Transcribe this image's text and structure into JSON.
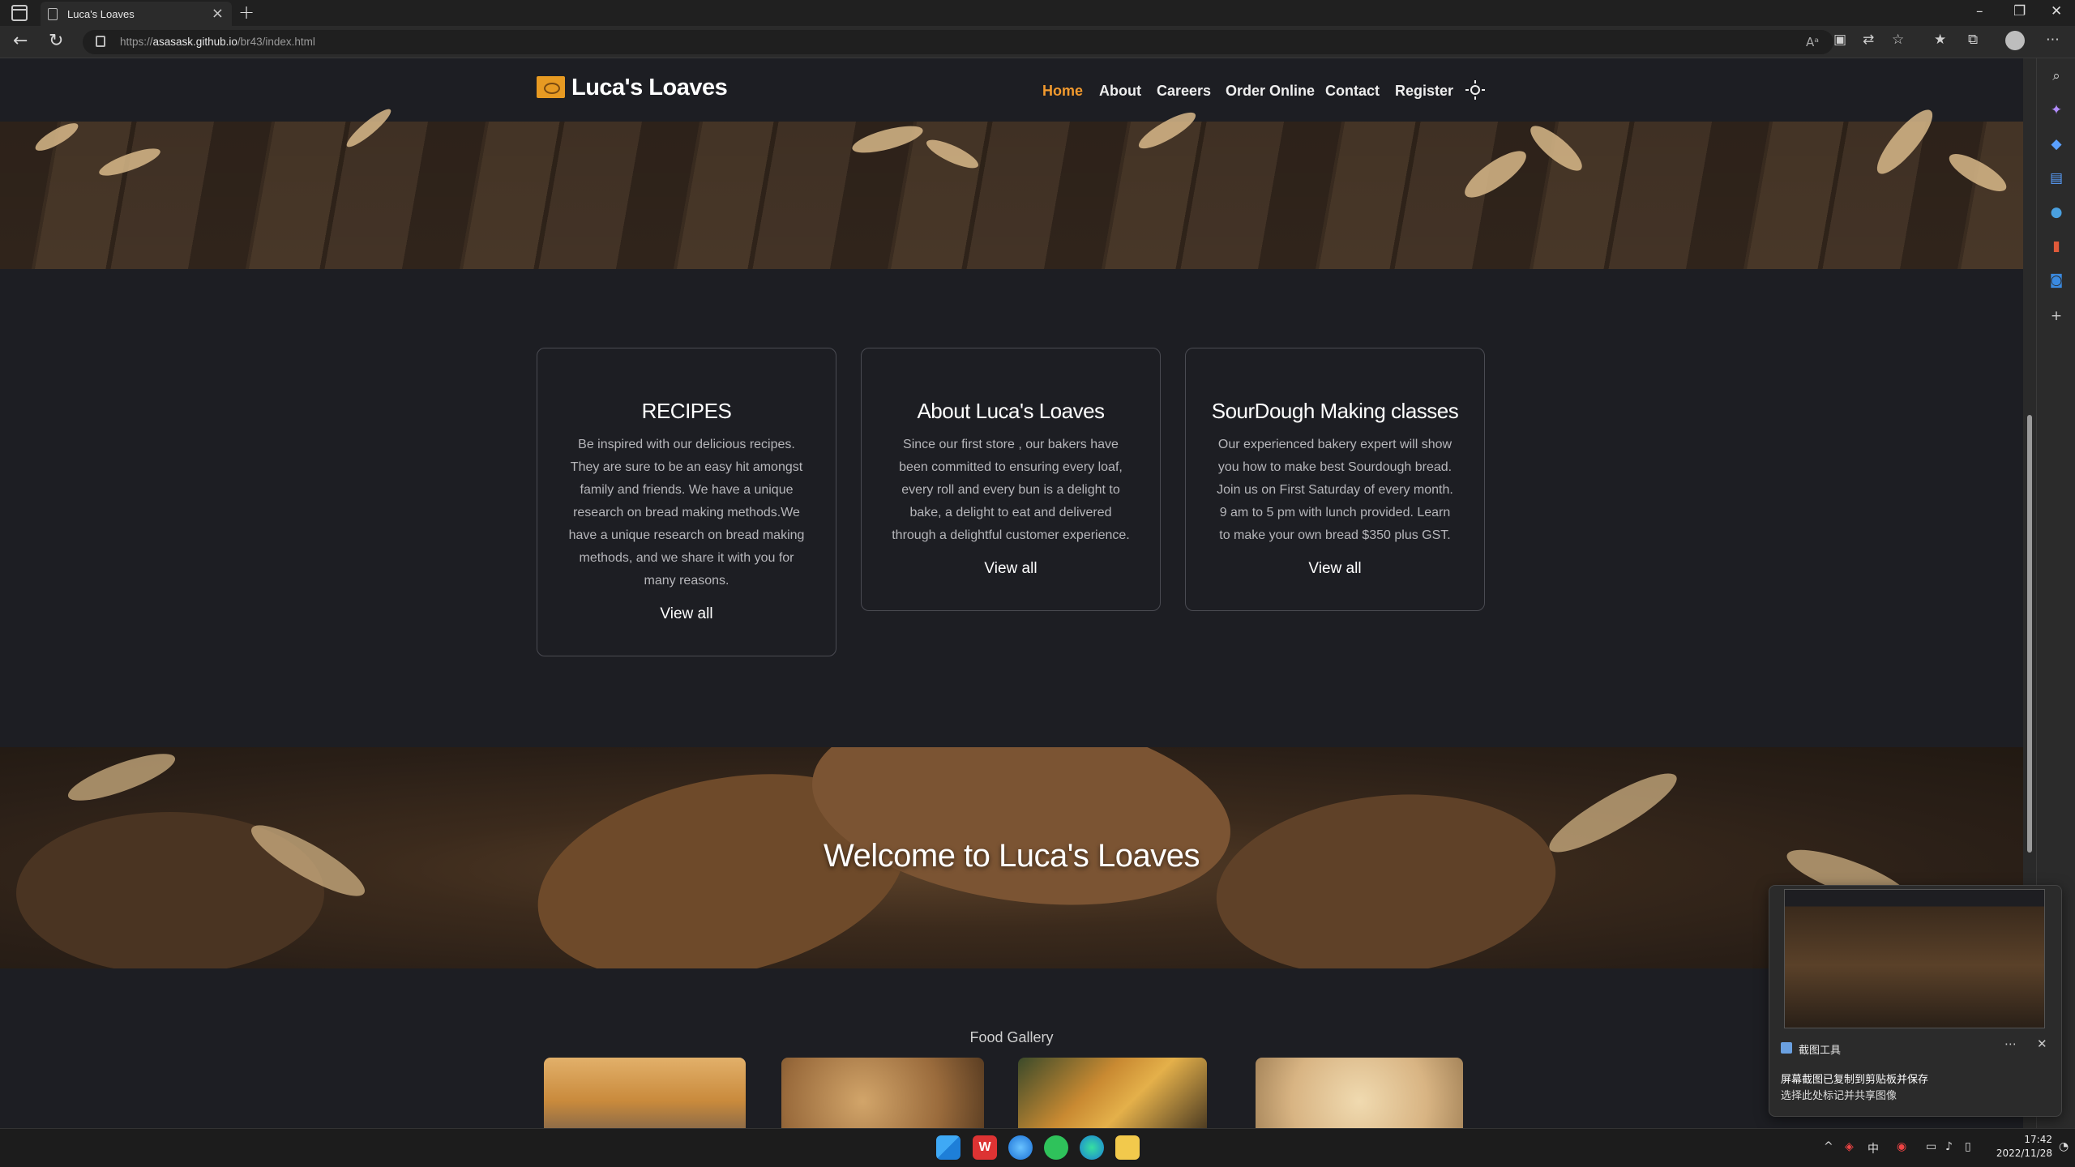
{
  "browser": {
    "tab_title": "Luca's Loaves",
    "new_tab_symbol": "+",
    "url_prefix": "https://",
    "url_host": "asasask.github.io",
    "url_path": "/br43/index.html"
  },
  "site": {
    "brand": "Luca's Loaves",
    "nav": [
      {
        "label": "Home",
        "active": true
      },
      {
        "label": "About"
      },
      {
        "label": "Careers"
      },
      {
        "label": "Order Online"
      },
      {
        "label": "Contact"
      },
      {
        "label": "Register"
      }
    ],
    "cards": [
      {
        "title": "RECIPES",
        "body": "Be inspired with our delicious recipes. They are sure to be an easy hit amongst family and friends. We have a unique research on bread making methods.We have a unique research on bread making methods, and we share it with you for many reasons.",
        "link": "View all"
      },
      {
        "title": "About Luca's Loaves",
        "body": "Since our first store , our bakers have been committed to ensuring every loaf, every roll and every bun is a delight to bake, a delight to eat and delivered through a delightful customer experience.",
        "link": "View all"
      },
      {
        "title": "SourDough Making classes",
        "body": "Our experienced bakery expert will show you how to make best Sourdough bread. Join us on First Saturday of every month. 9 am to 5 pm with lunch provided. Learn to make your own bread $350 plus GST.",
        "link": "View all"
      }
    ],
    "welcome": "Welcome to Luca's Loaves",
    "gallery_title": "Food Gallery"
  },
  "notification": {
    "app_name": "截图工具",
    "line1": "屏幕截图已复制到剪贴板并保存",
    "line2": "选择此处标记并共享图像"
  },
  "taskbar": {
    "ime": "中",
    "time": "17:42",
    "date": "2022/11/28"
  },
  "colors": {
    "accent": "#f29a2e",
    "logo": "#e79a22",
    "page_bg": "#1d1e23",
    "card_border": "#4a4b52"
  }
}
